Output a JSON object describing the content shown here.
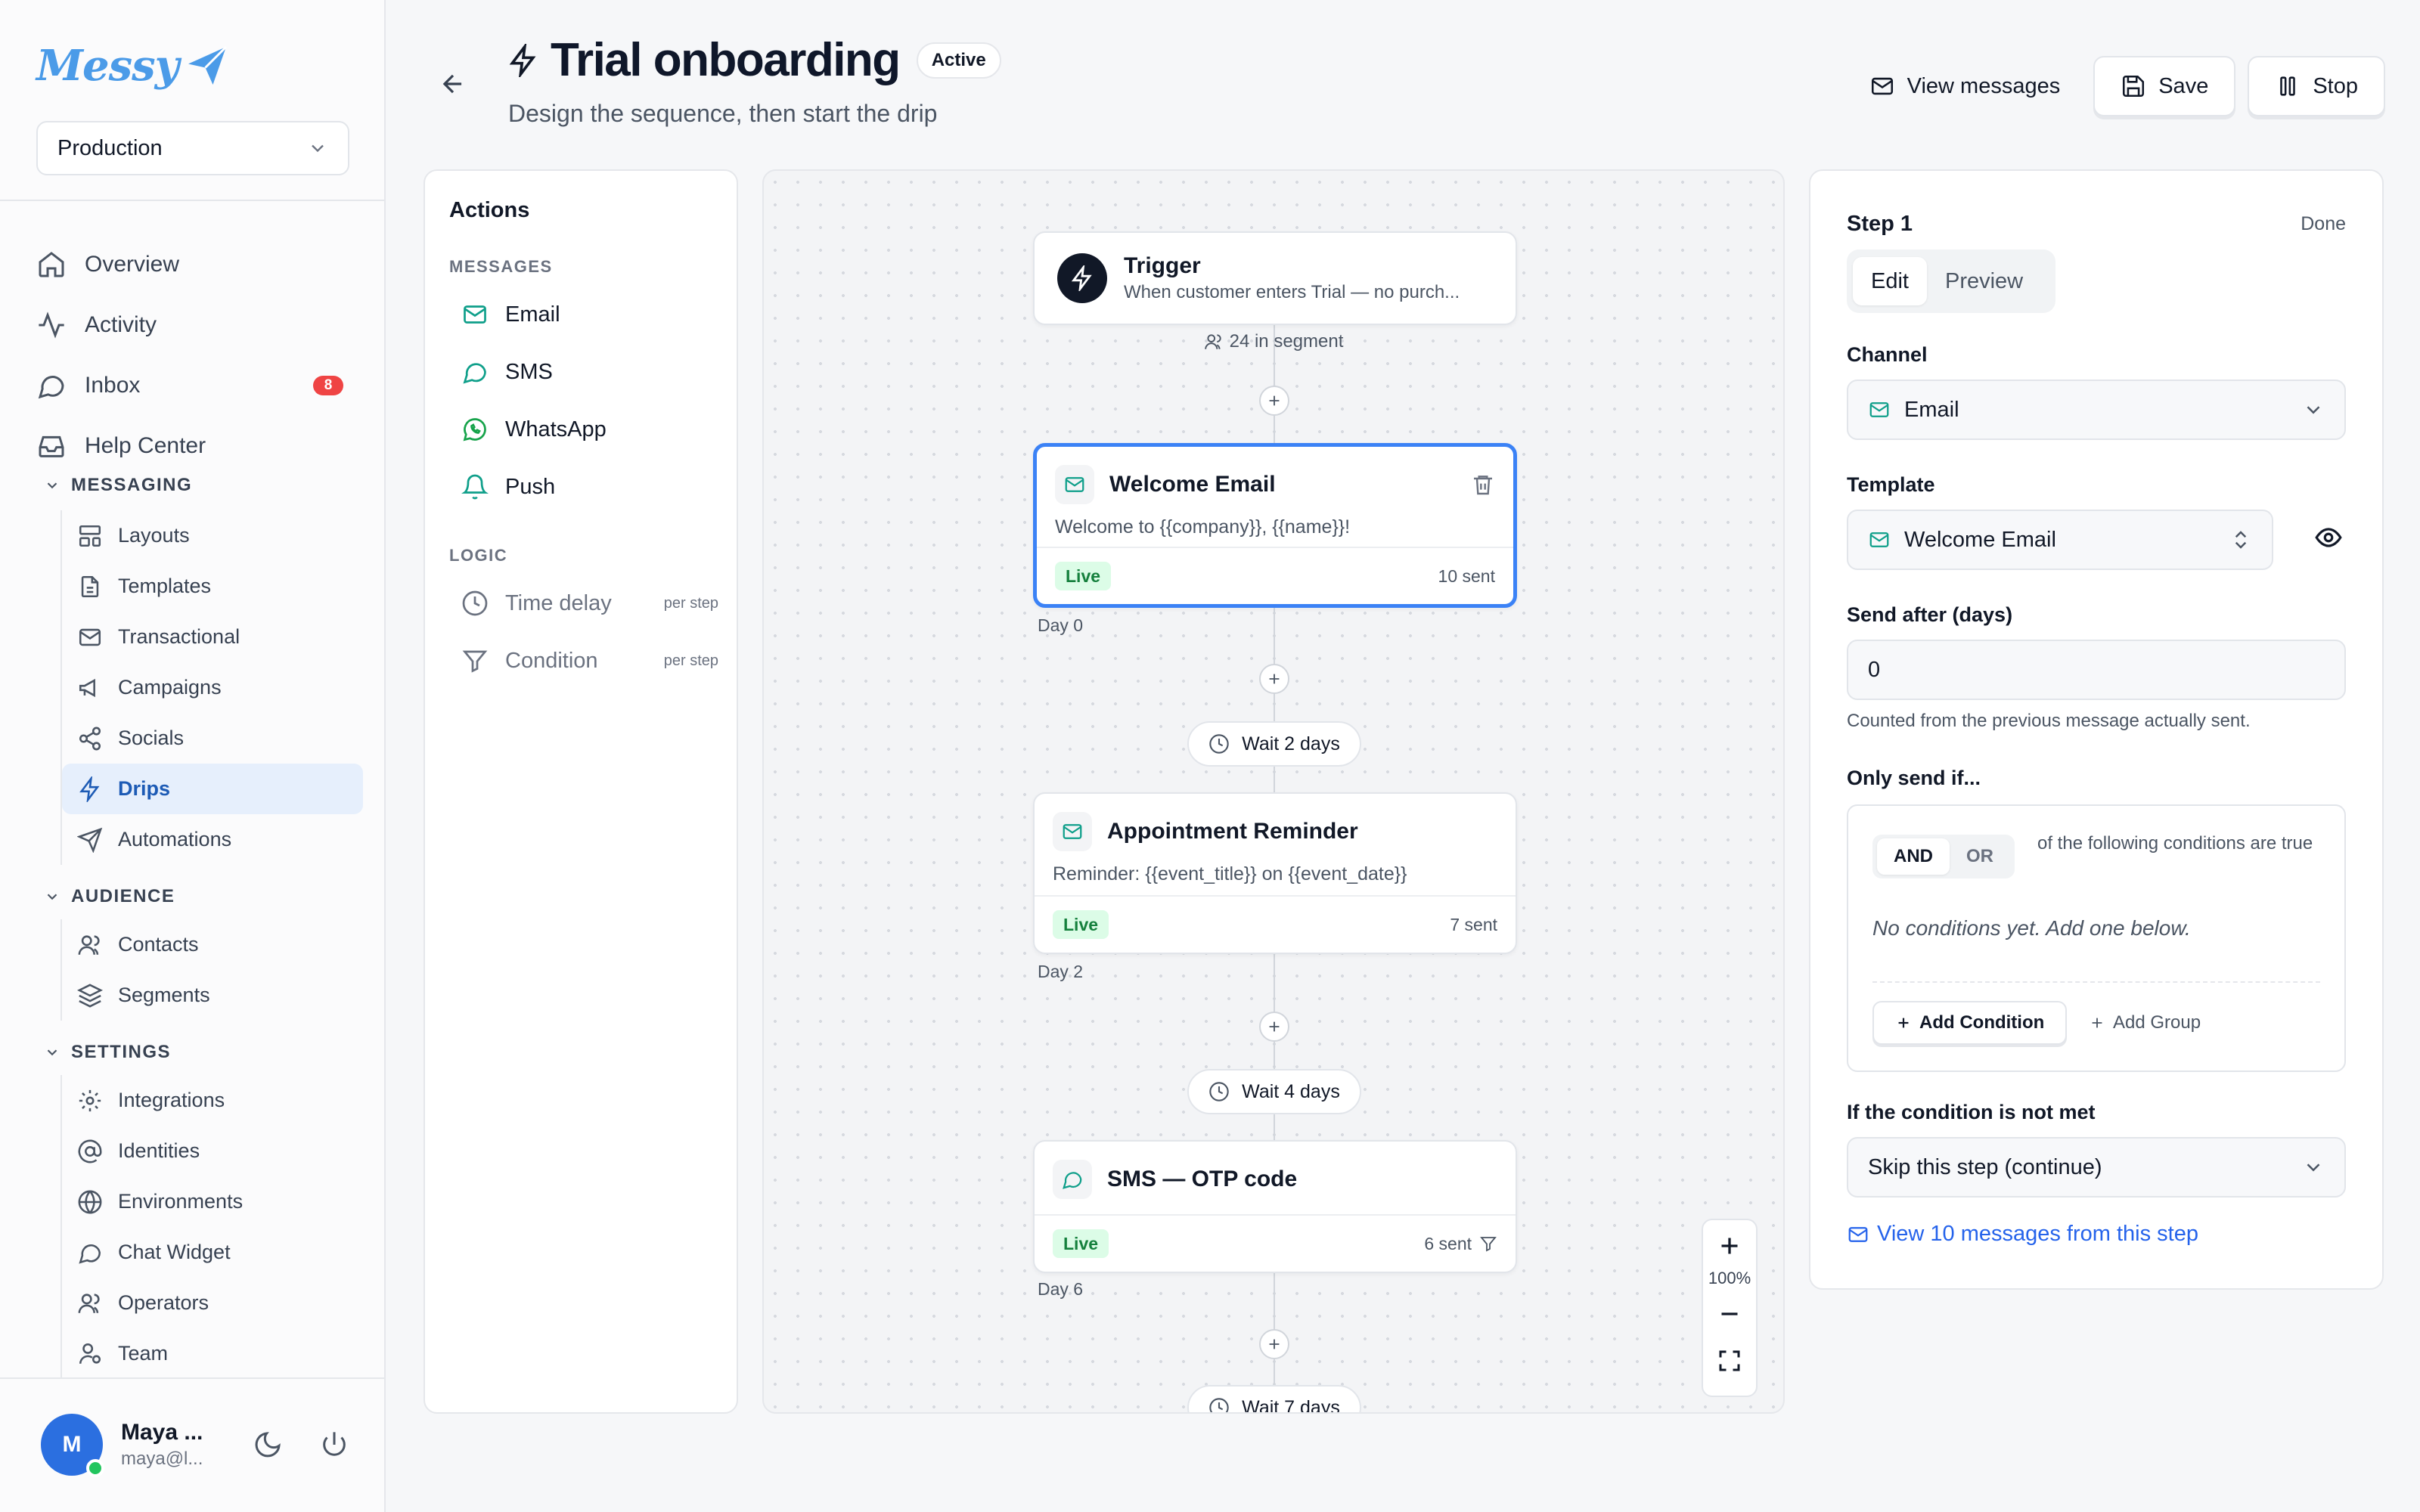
{
  "app": {
    "name": "Messy"
  },
  "environment": {
    "selected": "Production"
  },
  "nav": {
    "main": [
      {
        "label": "Overview",
        "icon": "home-icon"
      },
      {
        "label": "Activity",
        "icon": "activity-icon"
      },
      {
        "label": "Inbox",
        "icon": "chat-icon",
        "badge": "8"
      },
      {
        "label": "Help Center",
        "icon": "inbox-tray-icon"
      }
    ],
    "messaging": {
      "title": "MESSAGING",
      "items": [
        {
          "label": "Layouts"
        },
        {
          "label": "Templates"
        },
        {
          "label": "Transactional"
        },
        {
          "label": "Campaigns"
        },
        {
          "label": "Socials"
        },
        {
          "label": "Drips",
          "active": true
        },
        {
          "label": "Automations"
        }
      ]
    },
    "audience": {
      "title": "AUDIENCE",
      "items": [
        {
          "label": "Contacts"
        },
        {
          "label": "Segments"
        }
      ]
    },
    "settings": {
      "title": "SETTINGS",
      "items": [
        {
          "label": "Integrations"
        },
        {
          "label": "Identities"
        },
        {
          "label": "Environments"
        },
        {
          "label": "Chat Widget"
        },
        {
          "label": "Operators"
        },
        {
          "label": "Team"
        }
      ]
    }
  },
  "user": {
    "initial": "M",
    "name": "Maya ...",
    "email": "maya@l...",
    "status_color": "#22c55e"
  },
  "header": {
    "title": "Trial onboarding",
    "status": "Active",
    "subtitle": "Design the sequence, then start the drip",
    "view_messages": "View messages",
    "save": "Save",
    "stop": "Stop"
  },
  "actions_panel": {
    "title": "Actions",
    "messages_label": "MESSAGES",
    "messages": [
      "Email",
      "SMS",
      "WhatsApp",
      "Push"
    ],
    "logic_label": "LOGIC",
    "logic": [
      {
        "label": "Time delay",
        "note": "per step"
      },
      {
        "label": "Condition",
        "note": "per step"
      }
    ]
  },
  "flow": {
    "trigger": {
      "title": "Trigger",
      "subtitle": "When customer enters Trial — no purch...",
      "segment": "24 in segment"
    },
    "steps": [
      {
        "title": "Welcome Email",
        "subtitle": "Welcome to {{company}}, {{name}}!",
        "status": "Live",
        "sent": "10 sent",
        "day": "Day 0",
        "channel": "email"
      },
      {
        "wait": "Wait 2 days"
      },
      {
        "title": "Appointment Reminder",
        "subtitle": "Reminder: {{event_title}} on {{event_date}}",
        "status": "Live",
        "sent": "7 sent",
        "day": "Day 2",
        "channel": "email"
      },
      {
        "wait": "Wait 4 days"
      },
      {
        "title": "SMS — OTP code",
        "subtitle": "",
        "status": "Live",
        "sent": "6 sent",
        "day": "Day 6",
        "channel": "sms"
      },
      {
        "wait": "Wait 7 days"
      }
    ],
    "zoom": "100%"
  },
  "step_editor": {
    "title": "Step 1",
    "done": "Done",
    "tabs": [
      "Edit",
      "Preview"
    ],
    "channel_label": "Channel",
    "channel_value": "Email",
    "template_label": "Template",
    "template_value": "Welcome Email",
    "send_after_label": "Send after (days)",
    "send_after_value": "0",
    "send_after_hint": "Counted from the previous message actually sent.",
    "only_send_label": "Only send if...",
    "and_label": "AND",
    "or_label": "OR",
    "condition_desc": "of the following conditions are true",
    "no_conditions": "No conditions yet. Add one below.",
    "add_condition": "Add Condition",
    "add_group": "Add Group",
    "not_met_label": "If the condition is not met",
    "not_met_value": "Skip this step (continue)",
    "view_link": "View 10 messages from this step"
  },
  "colors": {
    "accent": "#3b82f6",
    "drips_active_bg": "#e6effc",
    "live_bg": "#dcfce7",
    "badge": "#ef4444",
    "channel_icon": "#0f9f8a"
  }
}
